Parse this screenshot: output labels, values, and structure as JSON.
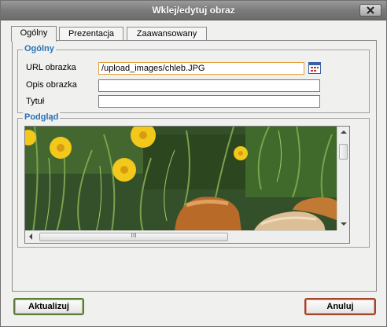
{
  "dialog": {
    "title": "Wklej/edytuj obraz",
    "close_icon": "close-icon"
  },
  "tabs": [
    {
      "label": "Ogólny",
      "active": true
    },
    {
      "label": "Prezentacja",
      "active": false
    },
    {
      "label": "Zaawansowany",
      "active": false
    }
  ],
  "general": {
    "legend": "Ogólny",
    "url_label": "URL obrazka",
    "url_value": "/upload_images/chleb.JPG",
    "description_label": "Opis obrazka",
    "description_value": "",
    "title_label": "Tytuł",
    "title_value": "",
    "browse_icon": "browse-icon"
  },
  "preview": {
    "legend": "Podgląd",
    "scroll_icons": [
      "arrow-up-icon",
      "arrow-down-icon",
      "arrow-left-icon",
      "arrow-right-icon"
    ],
    "thumb_grip": "III"
  },
  "buttons": {
    "update": "Aktualizuj",
    "cancel": "Anuluj"
  },
  "colors": {
    "titlebar": "#7b7b7b",
    "legend_text": "#2b6fb6",
    "ok_border": "#5c7a3c",
    "cancel_border": "#a0442a",
    "url_focus_border": "#e0a040"
  }
}
